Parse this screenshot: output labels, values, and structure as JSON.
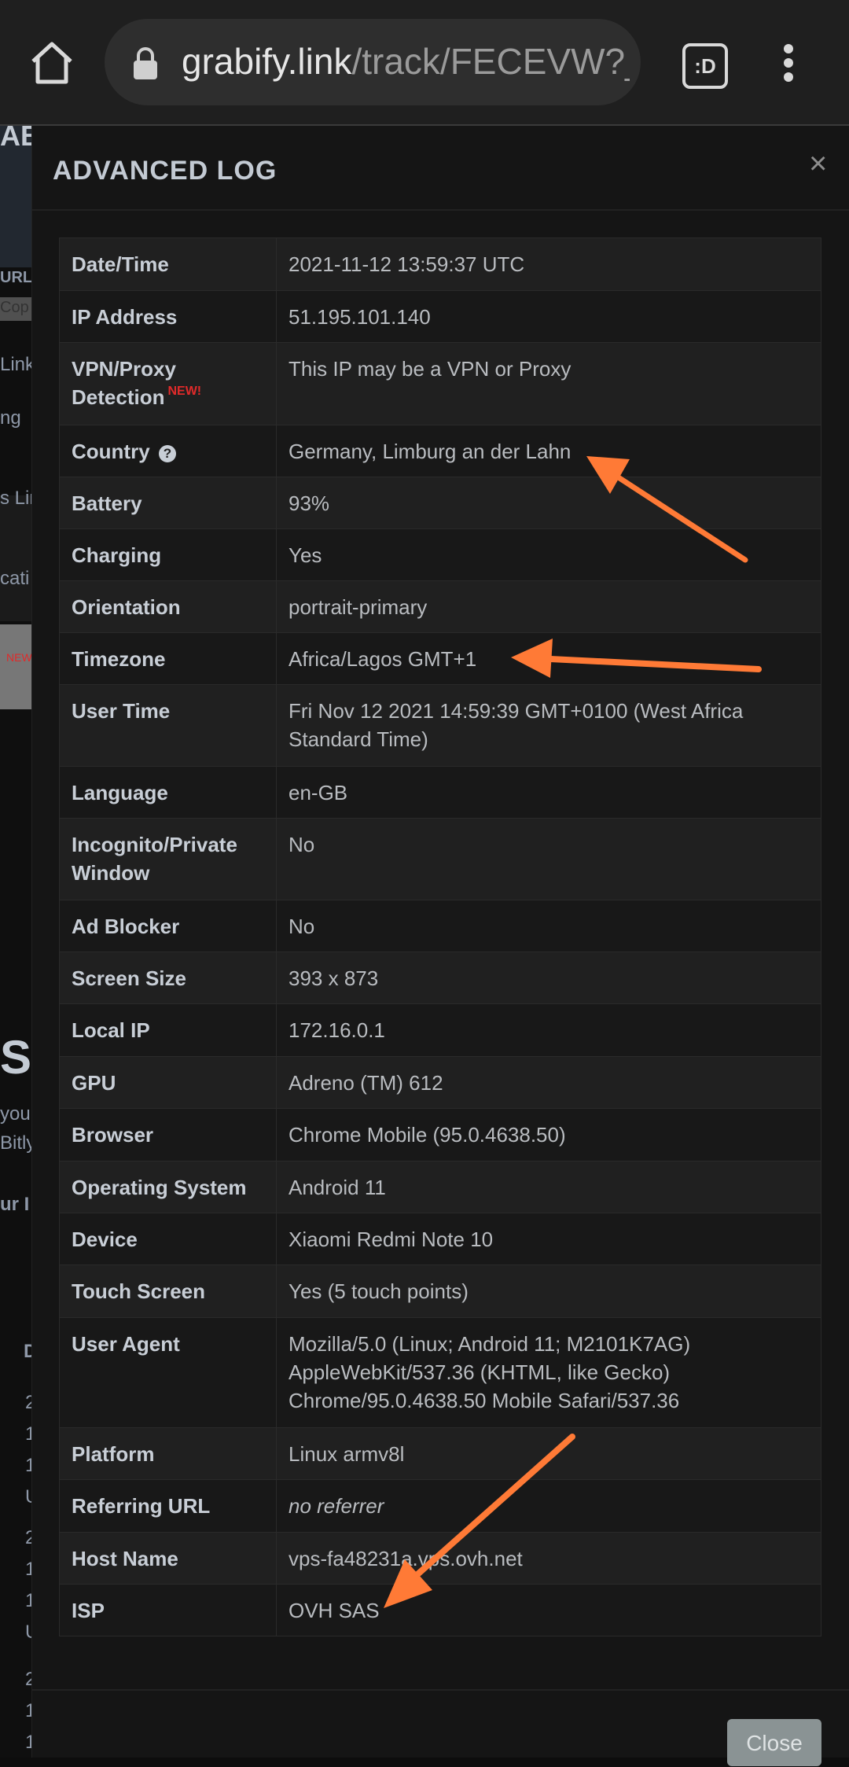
{
  "browser": {
    "url_host": "grabify.link",
    "url_path": "/track/FECEVW?_",
    "tab_label": ":D"
  },
  "background_fragments": [
    "AB",
    "URL",
    "Cop",
    "Link",
    "ng",
    "s Lin",
    "cati",
    "NEW",
    "SU",
    "you",
    "Bitly",
    "ur I",
    "D",
    "2",
    "1",
    "1",
    "U",
    "2",
    "1",
    "1",
    "U",
    "2",
    "1",
    "1"
  ],
  "modal": {
    "title": "ADVANCED LOG",
    "close_icon": "×",
    "rows": [
      {
        "key": "Date/Time",
        "value": "2021-11-12 13:59:37 UTC"
      },
      {
        "key": "IP Address",
        "value": "51.195.101.140"
      },
      {
        "key": "VPN/Proxy Detection",
        "value": "This IP may be a VPN or Proxy",
        "badge": "NEW!"
      },
      {
        "key": "Country",
        "value": "Germany, Limburg an der Lahn",
        "help_icon": "?"
      },
      {
        "key": "Battery",
        "value": "93%"
      },
      {
        "key": "Charging",
        "value": "Yes"
      },
      {
        "key": "Orientation",
        "value": "portrait-primary"
      },
      {
        "key": "Timezone",
        "value": "Africa/Lagos GMT+1"
      },
      {
        "key": "User Time",
        "value": "Fri Nov 12 2021 14:59:39 GMT+0100 (West Africa Standard Time)"
      },
      {
        "key": "Language",
        "value": "en-GB"
      },
      {
        "key": "Incognito/Private Window",
        "value": "No"
      },
      {
        "key": "Ad Blocker",
        "value": "No"
      },
      {
        "key": "Screen Size",
        "value": "393 x 873"
      },
      {
        "key": "Local IP",
        "value": "172.16.0.1"
      },
      {
        "key": "GPU",
        "value": "Adreno (TM) 612"
      },
      {
        "key": "Browser",
        "value": "Chrome Mobile (95.0.4638.50)"
      },
      {
        "key": "Operating System",
        "value": "Android 11"
      },
      {
        "key": "Device",
        "value": "Xiaomi Redmi Note 10"
      },
      {
        "key": "Touch Screen",
        "value": "Yes (5 touch points)"
      },
      {
        "key": "User Agent",
        "value": "Mozilla/5.0 (Linux; Android 11; M2101K7AG) AppleWebKit/537.36 (KHTML, like Gecko) Chrome/95.0.4638.50 Mobile Safari/537.36"
      },
      {
        "key": "Platform",
        "value": "Linux armv8l"
      },
      {
        "key": "Referring URL",
        "value": "no referrer",
        "italic": true
      },
      {
        "key": "Host Name",
        "value": "vps-fa48231a.vps.ovh.net"
      },
      {
        "key": "ISP",
        "value": "OVH SAS"
      }
    ],
    "close_button": "Close"
  },
  "colors": {
    "arrow": "#ff7a36",
    "badge": "#e02a2a"
  }
}
